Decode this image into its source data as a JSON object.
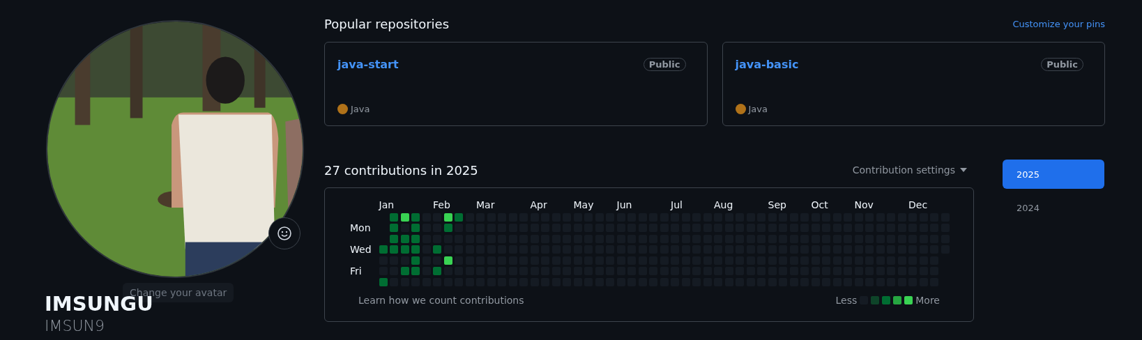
{
  "profile": {
    "tooltip": "Change your avatar",
    "name": "IMSUNGU",
    "login": "IMSUN9"
  },
  "popular": {
    "title": "Popular repositories",
    "link": "Customize your pins",
    "repos": [
      {
        "name": "java-start",
        "visibility": "Public",
        "language": "Java",
        "color": "#b07219"
      },
      {
        "name": "java-basic",
        "visibility": "Public",
        "language": "Java",
        "color": "#b07219"
      }
    ]
  },
  "contributions": {
    "title": "27 contributions in 2025",
    "settings": "Contribution settings",
    "day_labels": [
      "Mon",
      "Wed",
      "Fri"
    ],
    "weeks": [
      {
        "label": "Jan",
        "days": [
          {
            "color": "#006d32"
          },
          {
            "color": "#151b23"
          },
          {
            "color": "#151b23"
          },
          {
            "color": "#006d32"
          }
        ]
      },
      {
        "days": [
          {
            "color": "#006d32"
          },
          {
            "color": "#006d32"
          },
          {
            "color": "#006d32"
          },
          {
            "color": "#006d32"
          },
          {
            "color": "#151b23"
          },
          {
            "color": "#151b23"
          },
          {
            "color": "#151b23"
          }
        ]
      },
      {
        "days": [
          {
            "color": "#39d353"
          },
          {
            "color": "#151b23"
          },
          {
            "color": "#006d32"
          },
          {
            "color": "#006d32"
          },
          {
            "color": "#151b23"
          },
          {
            "color": "#006d32"
          },
          {
            "color": "#151b23"
          }
        ]
      },
      {
        "days": [
          {
            "color": "#006d32"
          },
          {
            "color": "#006d32"
          },
          {
            "color": "#006d32"
          },
          {
            "color": "#006d32"
          },
          {
            "color": "#006d32"
          },
          {
            "color": "#006d32"
          },
          {
            "color": "#151b23"
          }
        ]
      },
      {
        "days": [
          {
            "color": "#151b23"
          },
          {
            "color": "#151b23"
          },
          {
            "color": "#151b23"
          },
          {
            "color": "#151b23"
          },
          {
            "color": "#151b23"
          },
          {
            "color": "#151b23"
          },
          {
            "color": "#151b23"
          }
        ]
      },
      {
        "label": "Feb",
        "days": [
          {
            "color": "#151b23"
          },
          {
            "color": "#151b23"
          },
          {
            "color": "#151b23"
          },
          {
            "color": "#006d32"
          },
          {
            "color": "#151b23"
          },
          {
            "color": "#006d32"
          },
          {
            "color": "#151b23"
          }
        ]
      },
      {
        "days": [
          {
            "color": "#39d353"
          },
          {
            "color": "#006d32"
          },
          {
            "color": "#151b23"
          },
          {
            "color": "#151b23"
          },
          {
            "color": "#39d353"
          },
          {
            "color": "#151b23"
          },
          {
            "color": "#151b23"
          }
        ]
      },
      {
        "days": [
          {
            "color": "#006d32"
          },
          {
            "color": "#151b23"
          },
          {
            "color": "#151b23"
          },
          {
            "color": "#151b23"
          },
          {
            "color": "#151b23"
          },
          {
            "color": "#151b23"
          },
          {
            "color": "#151b23"
          }
        ]
      },
      {
        "days": [
          {
            "color": "#151b23"
          },
          {
            "color": "#151b23"
          },
          {
            "color": "#151b23"
          },
          {
            "color": "#151b23"
          },
          {
            "color": "#151b23"
          },
          {
            "color": "#151b23"
          },
          {
            "color": "#151b23"
          }
        ]
      },
      {
        "label": "Mar",
        "days": [
          {
            "color": "#151b23"
          },
          {
            "color": "#151b23"
          },
          {
            "color": "#151b23"
          },
          {
            "color": "#151b23"
          },
          {
            "color": "#151b23"
          },
          {
            "color": "#151b23"
          },
          {
            "color": "#151b23"
          }
        ]
      },
      {
        "days": [
          {
            "color": "#151b23"
          },
          {
            "color": "#151b23"
          },
          {
            "color": "#151b23"
          },
          {
            "color": "#151b23"
          },
          {
            "color": "#151b23"
          },
          {
            "color": "#151b23"
          },
          {
            "color": "#151b23"
          }
        ]
      },
      {
        "days": [
          {
            "color": "#151b23"
          },
          {
            "color": "#151b23"
          },
          {
            "color": "#151b23"
          },
          {
            "color": "#151b23"
          },
          {
            "color": "#151b23"
          },
          {
            "color": "#151b23"
          },
          {
            "color": "#151b23"
          }
        ]
      },
      {
        "days": [
          {
            "color": "#151b23"
          },
          {
            "color": "#151b23"
          },
          {
            "color": "#151b23"
          },
          {
            "color": "#151b23"
          },
          {
            "color": "#151b23"
          },
          {
            "color": "#151b23"
          },
          {
            "color": "#151b23"
          }
        ]
      },
      {
        "days": [
          {
            "color": "#151b23"
          },
          {
            "color": "#151b23"
          },
          {
            "color": "#151b23"
          },
          {
            "color": "#151b23"
          },
          {
            "color": "#151b23"
          },
          {
            "color": "#151b23"
          },
          {
            "color": "#151b23"
          }
        ]
      },
      {
        "label": "Apr",
        "days": [
          {
            "color": "#151b23"
          },
          {
            "color": "#151b23"
          },
          {
            "color": "#151b23"
          },
          {
            "color": "#151b23"
          },
          {
            "color": "#151b23"
          },
          {
            "color": "#151b23"
          },
          {
            "color": "#151b23"
          }
        ]
      },
      {
        "days": [
          {
            "color": "#151b23"
          },
          {
            "color": "#151b23"
          },
          {
            "color": "#151b23"
          },
          {
            "color": "#151b23"
          },
          {
            "color": "#151b23"
          },
          {
            "color": "#151b23"
          },
          {
            "color": "#151b23"
          }
        ]
      },
      {
        "days": [
          {
            "color": "#151b23"
          },
          {
            "color": "#151b23"
          },
          {
            "color": "#151b23"
          },
          {
            "color": "#151b23"
          },
          {
            "color": "#151b23"
          },
          {
            "color": "#151b23"
          },
          {
            "color": "#151b23"
          }
        ]
      },
      {
        "days": [
          {
            "color": "#151b23"
          },
          {
            "color": "#151b23"
          },
          {
            "color": "#151b23"
          },
          {
            "color": "#151b23"
          },
          {
            "color": "#151b23"
          },
          {
            "color": "#151b23"
          },
          {
            "color": "#151b23"
          }
        ]
      },
      {
        "label": "May",
        "days": [
          {
            "color": "#151b23"
          },
          {
            "color": "#151b23"
          },
          {
            "color": "#151b23"
          },
          {
            "color": "#151b23"
          },
          {
            "color": "#151b23"
          },
          {
            "color": "#151b23"
          },
          {
            "color": "#151b23"
          }
        ]
      },
      {
        "days": [
          {
            "color": "#151b23"
          },
          {
            "color": "#151b23"
          },
          {
            "color": "#151b23"
          },
          {
            "color": "#151b23"
          },
          {
            "color": "#151b23"
          },
          {
            "color": "#151b23"
          },
          {
            "color": "#151b23"
          }
        ]
      },
      {
        "days": [
          {
            "color": "#151b23"
          },
          {
            "color": "#151b23"
          },
          {
            "color": "#151b23"
          },
          {
            "color": "#151b23"
          },
          {
            "color": "#151b23"
          },
          {
            "color": "#151b23"
          },
          {
            "color": "#151b23"
          }
        ]
      },
      {
        "days": [
          {
            "color": "#151b23"
          },
          {
            "color": "#151b23"
          },
          {
            "color": "#151b23"
          },
          {
            "color": "#151b23"
          },
          {
            "color": "#151b23"
          },
          {
            "color": "#151b23"
          },
          {
            "color": "#151b23"
          }
        ]
      },
      {
        "label": "Jun",
        "days": [
          {
            "color": "#151b23"
          },
          {
            "color": "#151b23"
          },
          {
            "color": "#151b23"
          },
          {
            "color": "#151b23"
          },
          {
            "color": "#151b23"
          },
          {
            "color": "#151b23"
          },
          {
            "color": "#151b23"
          }
        ]
      },
      {
        "days": [
          {
            "color": "#151b23"
          },
          {
            "color": "#151b23"
          },
          {
            "color": "#151b23"
          },
          {
            "color": "#151b23"
          },
          {
            "color": "#151b23"
          },
          {
            "color": "#151b23"
          },
          {
            "color": "#151b23"
          }
        ]
      },
      {
        "days": [
          {
            "color": "#151b23"
          },
          {
            "color": "#151b23"
          },
          {
            "color": "#151b23"
          },
          {
            "color": "#151b23"
          },
          {
            "color": "#151b23"
          },
          {
            "color": "#151b23"
          },
          {
            "color": "#151b23"
          }
        ]
      },
      {
        "days": [
          {
            "color": "#151b23"
          },
          {
            "color": "#151b23"
          },
          {
            "color": "#151b23"
          },
          {
            "color": "#151b23"
          },
          {
            "color": "#151b23"
          },
          {
            "color": "#151b23"
          },
          {
            "color": "#151b23"
          }
        ]
      },
      {
        "days": [
          {
            "color": "#151b23"
          },
          {
            "color": "#151b23"
          },
          {
            "color": "#151b23"
          },
          {
            "color": "#151b23"
          },
          {
            "color": "#151b23"
          },
          {
            "color": "#151b23"
          },
          {
            "color": "#151b23"
          }
        ]
      },
      {
        "label": "Jul",
        "days": [
          {
            "color": "#151b23"
          },
          {
            "color": "#151b23"
          },
          {
            "color": "#151b23"
          },
          {
            "color": "#151b23"
          },
          {
            "color": "#151b23"
          },
          {
            "color": "#151b23"
          },
          {
            "color": "#151b23"
          }
        ]
      },
      {
        "days": [
          {
            "color": "#151b23"
          },
          {
            "color": "#151b23"
          },
          {
            "color": "#151b23"
          },
          {
            "color": "#151b23"
          },
          {
            "color": "#151b23"
          },
          {
            "color": "#151b23"
          },
          {
            "color": "#151b23"
          }
        ]
      },
      {
        "days": [
          {
            "color": "#151b23"
          },
          {
            "color": "#151b23"
          },
          {
            "color": "#151b23"
          },
          {
            "color": "#151b23"
          },
          {
            "color": "#151b23"
          },
          {
            "color": "#151b23"
          },
          {
            "color": "#151b23"
          }
        ]
      },
      {
        "days": [
          {
            "color": "#151b23"
          },
          {
            "color": "#151b23"
          },
          {
            "color": "#151b23"
          },
          {
            "color": "#151b23"
          },
          {
            "color": "#151b23"
          },
          {
            "color": "#151b23"
          },
          {
            "color": "#151b23"
          }
        ]
      },
      {
        "label": "Aug",
        "days": [
          {
            "color": "#151b23"
          },
          {
            "color": "#151b23"
          },
          {
            "color": "#151b23"
          },
          {
            "color": "#151b23"
          },
          {
            "color": "#151b23"
          },
          {
            "color": "#151b23"
          },
          {
            "color": "#151b23"
          }
        ]
      },
      {
        "days": [
          {
            "color": "#151b23"
          },
          {
            "color": "#151b23"
          },
          {
            "color": "#151b23"
          },
          {
            "color": "#151b23"
          },
          {
            "color": "#151b23"
          },
          {
            "color": "#151b23"
          },
          {
            "color": "#151b23"
          }
        ]
      },
      {
        "days": [
          {
            "color": "#151b23"
          },
          {
            "color": "#151b23"
          },
          {
            "color": "#151b23"
          },
          {
            "color": "#151b23"
          },
          {
            "color": "#151b23"
          },
          {
            "color": "#151b23"
          },
          {
            "color": "#151b23"
          }
        ]
      },
      {
        "days": [
          {
            "color": "#151b23"
          },
          {
            "color": "#151b23"
          },
          {
            "color": "#151b23"
          },
          {
            "color": "#151b23"
          },
          {
            "color": "#151b23"
          },
          {
            "color": "#151b23"
          },
          {
            "color": "#151b23"
          }
        ]
      },
      {
        "days": [
          {
            "color": "#151b23"
          },
          {
            "color": "#151b23"
          },
          {
            "color": "#151b23"
          },
          {
            "color": "#151b23"
          },
          {
            "color": "#151b23"
          },
          {
            "color": "#151b23"
          },
          {
            "color": "#151b23"
          }
        ]
      },
      {
        "label": "Sep",
        "days": [
          {
            "color": "#151b23"
          },
          {
            "color": "#151b23"
          },
          {
            "color": "#151b23"
          },
          {
            "color": "#151b23"
          },
          {
            "color": "#151b23"
          },
          {
            "color": "#151b23"
          },
          {
            "color": "#151b23"
          }
        ]
      },
      {
        "days": [
          {
            "color": "#151b23"
          },
          {
            "color": "#151b23"
          },
          {
            "color": "#151b23"
          },
          {
            "color": "#151b23"
          },
          {
            "color": "#151b23"
          },
          {
            "color": "#151b23"
          },
          {
            "color": "#151b23"
          }
        ]
      },
      {
        "days": [
          {
            "color": "#151b23"
          },
          {
            "color": "#151b23"
          },
          {
            "color": "#151b23"
          },
          {
            "color": "#151b23"
          },
          {
            "color": "#151b23"
          },
          {
            "color": "#151b23"
          },
          {
            "color": "#151b23"
          }
        ]
      },
      {
        "days": [
          {
            "color": "#151b23"
          },
          {
            "color": "#151b23"
          },
          {
            "color": "#151b23"
          },
          {
            "color": "#151b23"
          },
          {
            "color": "#151b23"
          },
          {
            "color": "#151b23"
          },
          {
            "color": "#151b23"
          }
        ]
      },
      {
        "label": "Oct",
        "days": [
          {
            "color": "#151b23"
          },
          {
            "color": "#151b23"
          },
          {
            "color": "#151b23"
          },
          {
            "color": "#151b23"
          },
          {
            "color": "#151b23"
          },
          {
            "color": "#151b23"
          },
          {
            "color": "#151b23"
          }
        ]
      },
      {
        "days": [
          {
            "color": "#151b23"
          },
          {
            "color": "#151b23"
          },
          {
            "color": "#151b23"
          },
          {
            "color": "#151b23"
          },
          {
            "color": "#151b23"
          },
          {
            "color": "#151b23"
          },
          {
            "color": "#151b23"
          }
        ]
      },
      {
        "days": [
          {
            "color": "#151b23"
          },
          {
            "color": "#151b23"
          },
          {
            "color": "#151b23"
          },
          {
            "color": "#151b23"
          },
          {
            "color": "#151b23"
          },
          {
            "color": "#151b23"
          },
          {
            "color": "#151b23"
          }
        ]
      },
      {
        "days": [
          {
            "color": "#151b23"
          },
          {
            "color": "#151b23"
          },
          {
            "color": "#151b23"
          },
          {
            "color": "#151b23"
          },
          {
            "color": "#151b23"
          },
          {
            "color": "#151b23"
          },
          {
            "color": "#151b23"
          }
        ]
      },
      {
        "label": "Nov",
        "days": [
          {
            "color": "#151b23"
          },
          {
            "color": "#151b23"
          },
          {
            "color": "#151b23"
          },
          {
            "color": "#151b23"
          },
          {
            "color": "#151b23"
          },
          {
            "color": "#151b23"
          },
          {
            "color": "#151b23"
          }
        ]
      },
      {
        "days": [
          {
            "color": "#151b23"
          },
          {
            "color": "#151b23"
          },
          {
            "color": "#151b23"
          },
          {
            "color": "#151b23"
          },
          {
            "color": "#151b23"
          },
          {
            "color": "#151b23"
          },
          {
            "color": "#151b23"
          }
        ]
      },
      {
        "days": [
          {
            "color": "#151b23"
          },
          {
            "color": "#151b23"
          },
          {
            "color": "#151b23"
          },
          {
            "color": "#151b23"
          },
          {
            "color": "#151b23"
          },
          {
            "color": "#151b23"
          },
          {
            "color": "#151b23"
          }
        ]
      },
      {
        "days": [
          {
            "color": "#151b23"
          },
          {
            "color": "#151b23"
          },
          {
            "color": "#151b23"
          },
          {
            "color": "#151b23"
          },
          {
            "color": "#151b23"
          },
          {
            "color": "#151b23"
          },
          {
            "color": "#151b23"
          }
        ]
      },
      {
        "days": [
          {
            "color": "#151b23"
          },
          {
            "color": "#151b23"
          },
          {
            "color": "#151b23"
          },
          {
            "color": "#151b23"
          },
          {
            "color": "#151b23"
          },
          {
            "color": "#151b23"
          },
          {
            "color": "#151b23"
          }
        ]
      },
      {
        "label": "Dec",
        "days": [
          {
            "color": "#151b23"
          },
          {
            "color": "#151b23"
          },
          {
            "color": "#151b23"
          },
          {
            "color": "#151b23"
          },
          {
            "color": "#151b23"
          },
          {
            "color": "#151b23"
          },
          {
            "color": "#151b23"
          }
        ]
      },
      {
        "days": [
          {
            "color": "#151b23"
          },
          {
            "color": "#151b23"
          },
          {
            "color": "#151b23"
          },
          {
            "color": "#151b23"
          },
          {
            "color": "#151b23"
          },
          {
            "color": "#151b23"
          },
          {
            "color": "#151b23"
          }
        ]
      },
      {
        "days": [
          {
            "color": "#151b23"
          },
          {
            "color": "#151b23"
          },
          {
            "color": "#151b23"
          },
          {
            "color": "#151b23"
          },
          {
            "color": "#151b23"
          },
          {
            "color": "#151b23"
          },
          {
            "color": "#151b23"
          }
        ]
      },
      {
        "days": [
          {
            "color": "#151b23"
          },
          {
            "color": "#151b23"
          },
          {
            "color": "#151b23"
          },
          {
            "color": "#151b23"
          }
        ]
      }
    ],
    "footer_link": "Learn how we count contributions",
    "legend": {
      "less": "Less",
      "more": "More",
      "swatches": [
        {
          "color": "#151b23"
        },
        {
          "color": "#0e4429"
        },
        {
          "color": "#006d32"
        },
        {
          "color": "#26a641"
        },
        {
          "color": "#39d353"
        }
      ]
    }
  },
  "years": [
    {
      "label": "2025",
      "selected": true
    },
    {
      "label": "2024",
      "selected": false
    }
  ]
}
